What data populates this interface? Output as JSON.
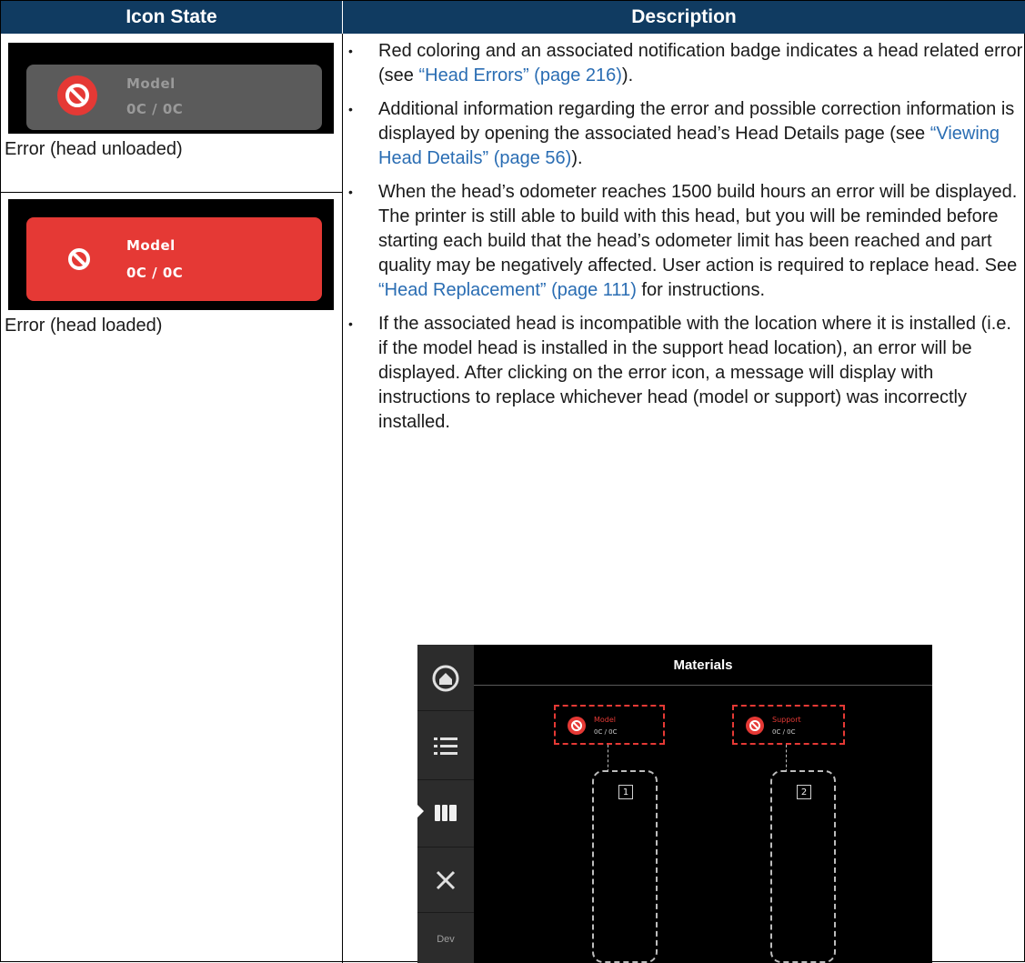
{
  "headers": {
    "icon_state": "Icon State",
    "description": "Description"
  },
  "icons": [
    {
      "line1": "Model",
      "line2": "0C / 0C",
      "caption": "Error (head unloaded)"
    },
    {
      "line1": "Model",
      "line2": "0C / 0C",
      "caption": "Error (head loaded)"
    }
  ],
  "bullets": [
    {
      "pre": "Red coloring and an associated notification badge indicates a head related error (see ",
      "link": "“Head Errors” (page 216)",
      "post": ")."
    },
    {
      "pre": "Additional information regarding the error and possible correction information is displayed by opening the associated head’s Head Details page (see ",
      "link": "“Viewing Head Details” (page 56)",
      "post": ")."
    },
    {
      "pre": "When the head’s odometer reaches 1500 build hours an error will be displayed. The printer is still able to build with this head, but you will be reminded before starting each build that the head’s odometer limit has been reached and part quality may be negatively affected. User action is required to replace head. See ",
      "link": "“Head Replacement” (page 111)",
      "post": " for instructions."
    },
    {
      "pre": "If the associated head is incompatible with the location where it is installed (i.e. if the model head is installed in the support head location), an error will be displayed. After clicking on the error icon, a message will display with instructions to replace whichever head (model or support) was incorrectly installed.",
      "link": "",
      "post": ""
    }
  ],
  "screenshot": {
    "title": "Materials",
    "sidebar_dev_label": "Dev",
    "heads": [
      {
        "label": "Model",
        "value": "0C / 0C",
        "slot": "1"
      },
      {
        "label": "Support",
        "value": "0C / 0C",
        "slot": "2"
      }
    ]
  },
  "colors": {
    "header_bg": "#103b61",
    "error_red": "#e53935",
    "tile_grey": "#5b5b5b",
    "link": "#2a6db3"
  }
}
